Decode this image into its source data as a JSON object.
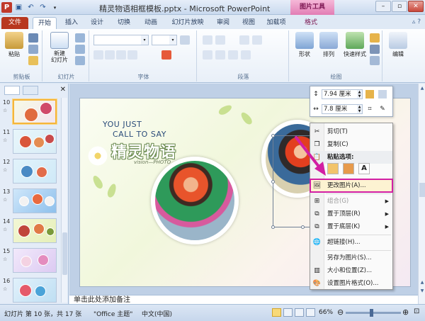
{
  "titlebar": {
    "title": "精灵物语相框模板.pptx - Microsoft PowerPoint",
    "context_tab_group": "图片工具"
  },
  "tabs": [
    {
      "label": "文件"
    },
    {
      "label": "开始"
    },
    {
      "label": "插入"
    },
    {
      "label": "设计"
    },
    {
      "label": "切换"
    },
    {
      "label": "动画"
    },
    {
      "label": "幻灯片放映"
    },
    {
      "label": "审阅"
    },
    {
      "label": "视图"
    },
    {
      "label": "加载项"
    },
    {
      "label": "格式"
    }
  ],
  "ribbon": {
    "groups": {
      "clipboard": {
        "label": "剪贴板",
        "paste": "粘贴"
      },
      "slides": {
        "label": "幻灯片",
        "new_slide": "新建\n幻灯片"
      },
      "font": {
        "label": "字体"
      },
      "paragraph": {
        "label": "段落"
      },
      "drawing": {
        "label": "绘图",
        "shapes": "形状",
        "arrange": "排列",
        "quick_styles": "快速样式"
      },
      "editing": {
        "label": "编辑"
      }
    }
  },
  "thumbnails": [
    {
      "number": "10",
      "selected": true
    },
    {
      "number": "11",
      "selected": false
    },
    {
      "number": "12",
      "selected": false
    },
    {
      "number": "13",
      "selected": false
    },
    {
      "number": "14",
      "selected": false
    },
    {
      "number": "15",
      "selected": false
    },
    {
      "number": "16",
      "selected": false
    }
  ],
  "slide": {
    "line1": "YOU JUST",
    "line2": "CALL TO SAY",
    "title": "精灵物语",
    "subtitle": "vision—PHOTO"
  },
  "mini_toolbar": {
    "height": "7.94 厘米",
    "width": "7.8 厘米"
  },
  "context_menu": {
    "items": [
      {
        "label": "剪切(T)",
        "icon": "scissors-icon"
      },
      {
        "label": "复制(C)",
        "icon": "copy-icon"
      },
      {
        "label": "粘贴选项:",
        "icon": "paste-icon"
      },
      {
        "label": "更改图片(A)...",
        "icon": "change-picture-icon"
      },
      {
        "label": "组合(G)",
        "icon": "group-icon"
      },
      {
        "label": "置于顶层(R)",
        "icon": "bring-front-icon"
      },
      {
        "label": "置于底层(K)",
        "icon": "send-back-icon"
      },
      {
        "label": "超链接(H)...",
        "icon": "hyperlink-icon"
      },
      {
        "label": "另存为图片(S)...",
        "icon": "save-picture-icon"
      },
      {
        "label": "大小和位置(Z)...",
        "icon": "size-icon"
      },
      {
        "label": "设置图片格式(O)...",
        "icon": "format-picture-icon"
      }
    ]
  },
  "notes": {
    "placeholder": "单击此处添加备注"
  },
  "statusbar": {
    "slide_info": "幻灯片 第 10 张，共 17 张",
    "theme": "\"Office 主题\"",
    "language": "中文(中国)",
    "zoom": "66%"
  },
  "colors": {
    "file_tab": "#b8371f",
    "picture_tools": "#e27db4",
    "highlight_outline": "#d21fa3"
  }
}
